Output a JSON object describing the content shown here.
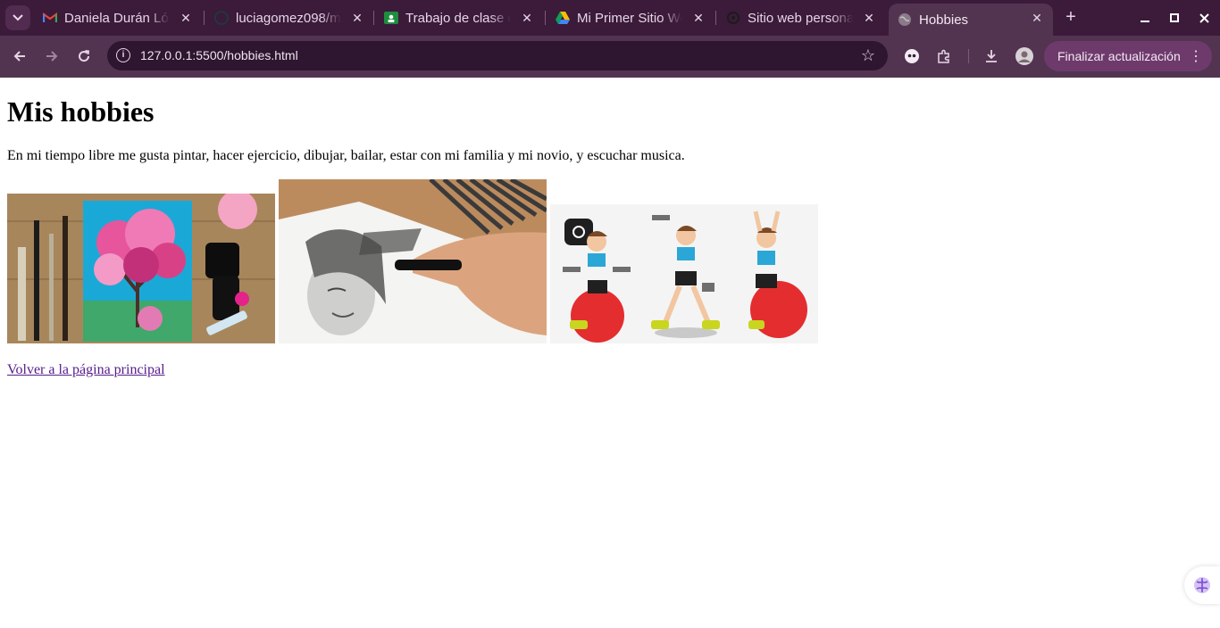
{
  "browser": {
    "tabs": [
      {
        "title": "Daniela Durán López",
        "icon": "gmail-icon"
      },
      {
        "title": "luciagomez098/m",
        "icon": "github-icon"
      },
      {
        "title": "Trabajo de clase de",
        "icon": "classroom-icon"
      },
      {
        "title": "Mi Primer Sitio Web",
        "icon": "drive-icon"
      },
      {
        "title": "Sitio web personal",
        "icon": "chatgpt-icon"
      },
      {
        "title": "Hobbies",
        "icon": "globe-icon"
      }
    ],
    "active_tab": "Hobbies",
    "url": "127.0.0.1:5500/hobbies.html",
    "update_button": "Finalizar actualización",
    "accent": "#3b1a3a"
  },
  "page": {
    "heading": "Mis hobbies",
    "intro": "En mi tiempo libre me gusta pintar, hacer ejercicio, dibujar, bailar, estar con mi familia y mi novio, y escuchar musica.",
    "images": [
      "painting-image",
      "drawing-image",
      "exercise-image"
    ],
    "back_link": "Volver a la página principal",
    "link_color": "#551a8b"
  }
}
